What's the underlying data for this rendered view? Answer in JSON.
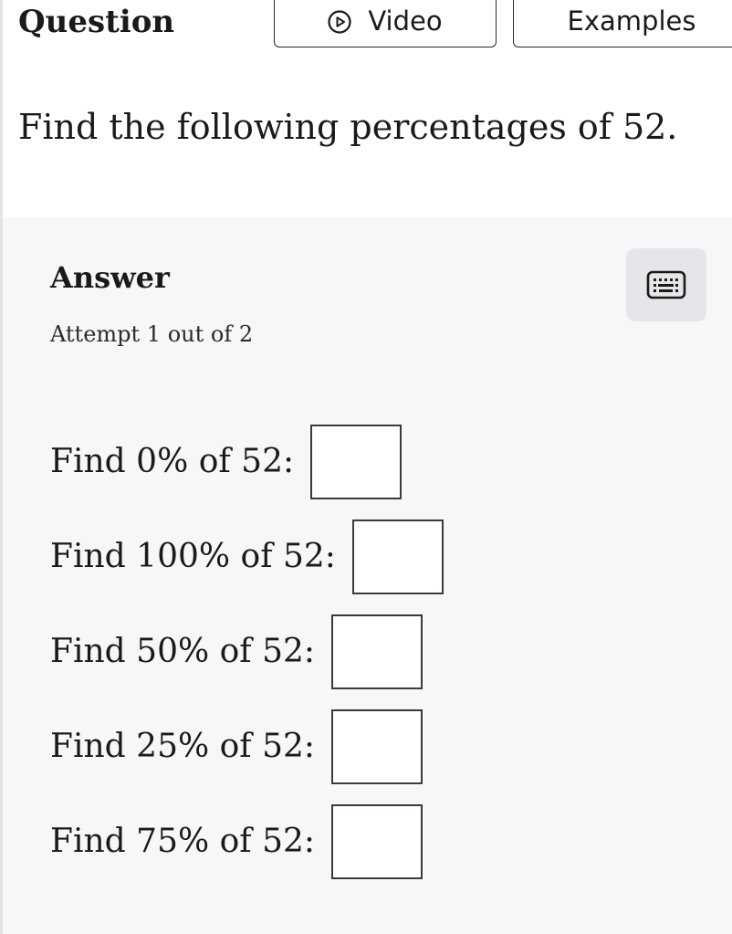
{
  "header": {
    "question_label": "Question",
    "tabs": [
      {
        "label": "Video",
        "icon": "play-icon"
      },
      {
        "label": "Examples"
      }
    ]
  },
  "prompt": "Find the following percentages of 52.",
  "answer": {
    "heading": "Answer",
    "keyboard_icon": "keyboard-icon",
    "attempt": "Attempt 1 out of 2",
    "rows": [
      {
        "label": "Find 0% of 52:",
        "value": ""
      },
      {
        "label": "Find 100% of 52:",
        "value": ""
      },
      {
        "label": "Find 50% of 52:",
        "value": ""
      },
      {
        "label": "Find 25% of 52:",
        "value": ""
      },
      {
        "label": "Find 75% of 52:",
        "value": ""
      }
    ]
  },
  "colors": {
    "panel_background": "#f6f7f8",
    "keyboard_button": "#e4e6e9",
    "text": "#1a1a1a"
  }
}
